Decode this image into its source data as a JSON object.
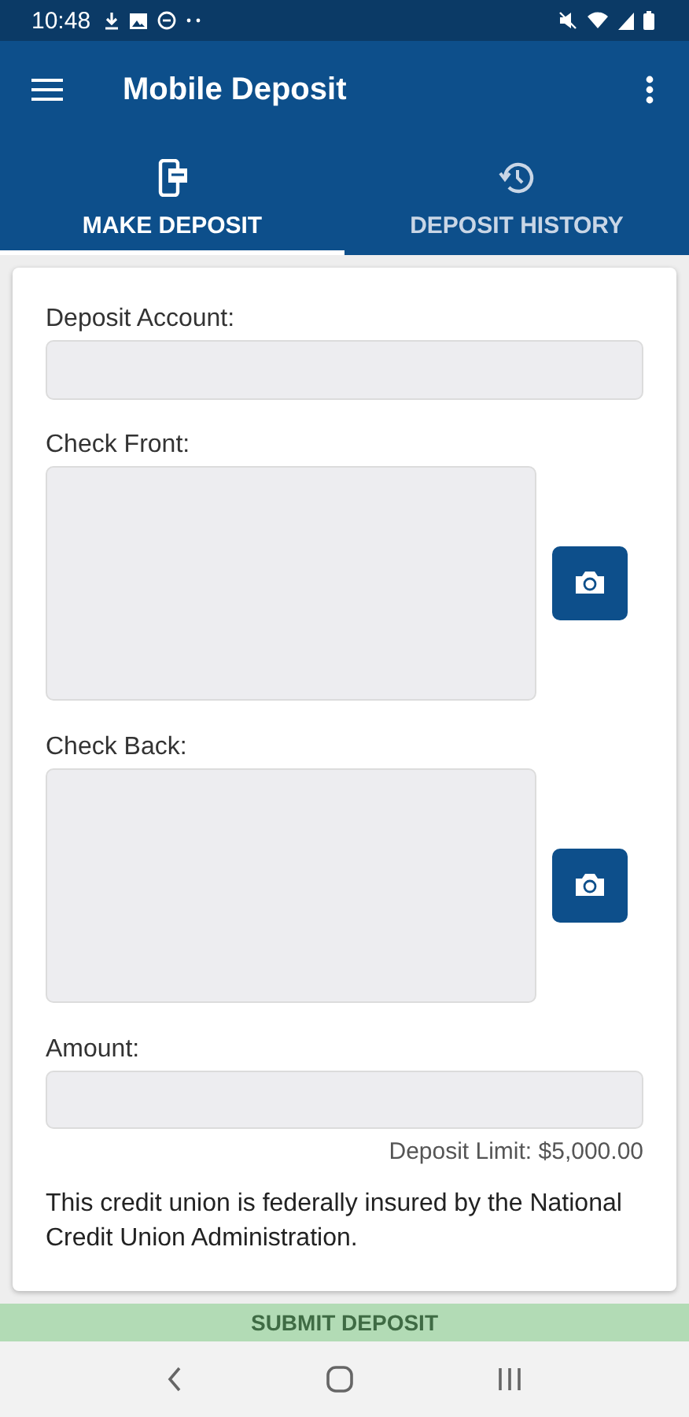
{
  "status_bar": {
    "time": "10:48"
  },
  "app_bar": {
    "title": "Mobile Deposit"
  },
  "tabs": [
    {
      "label": "MAKE DEPOSIT",
      "kind": "make",
      "selected": true
    },
    {
      "label": "DEPOSIT HISTORY",
      "kind": "history",
      "selected": false
    }
  ],
  "form": {
    "fields": [
      {
        "kind": "input",
        "label": "Deposit Account:"
      },
      {
        "kind": "image",
        "label": "Check Front:"
      },
      {
        "kind": "image",
        "label": "Check Back:"
      },
      {
        "kind": "input",
        "label": "Amount:"
      }
    ],
    "limit": "Deposit Limit: $5,000.00",
    "notice": "This credit union is federally insured by the National Credit Union Administration."
  },
  "submit_button": {
    "label": "SUBMIT DEPOSIT",
    "disabled": true
  }
}
